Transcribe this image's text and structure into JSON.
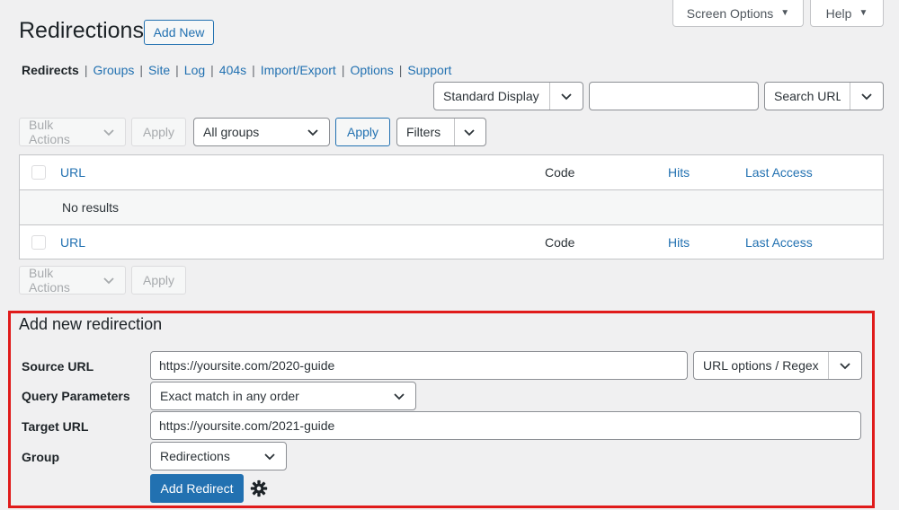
{
  "top_tabs": {
    "screen_options": "Screen Options",
    "help": "Help"
  },
  "header": {
    "title": "Redirections",
    "add_new": "Add New"
  },
  "subnav": {
    "items": [
      "Redirects",
      "Groups",
      "Site",
      "Log",
      "404s",
      "Import/Export",
      "Options",
      "Support"
    ],
    "separator": "|",
    "current": "Redirects"
  },
  "search": {
    "display_select": "Standard Display",
    "input_value": "",
    "search_type": "Search URL"
  },
  "toolbar_top": {
    "bulk_actions": "Bulk Actions",
    "apply_disabled": "Apply",
    "groups_select": "All groups",
    "apply": "Apply",
    "filters": "Filters"
  },
  "table": {
    "columns": [
      "URL",
      "Code",
      "Hits",
      "Last Access"
    ],
    "empty_message": "No results"
  },
  "toolbar_bottom": {
    "bulk_actions": "Bulk Actions",
    "apply": "Apply"
  },
  "add_redirection": {
    "title": "Add new redirection",
    "source_url_label": "Source URL",
    "source_url_value": "https://yoursite.com/2020-guide",
    "url_options": "URL options / Regex",
    "query_params_label": "Query Parameters",
    "query_params_value": "Exact match in any order",
    "target_url_label": "Target URL",
    "target_url_value": "https://yoursite.com/2021-guide",
    "group_label": "Group",
    "group_value": "Redirections",
    "submit": "Add Redirect"
  },
  "colors": {
    "accent": "#2271b1",
    "highlight_border": "#e01b1b",
    "background": "#f0f0f1"
  }
}
